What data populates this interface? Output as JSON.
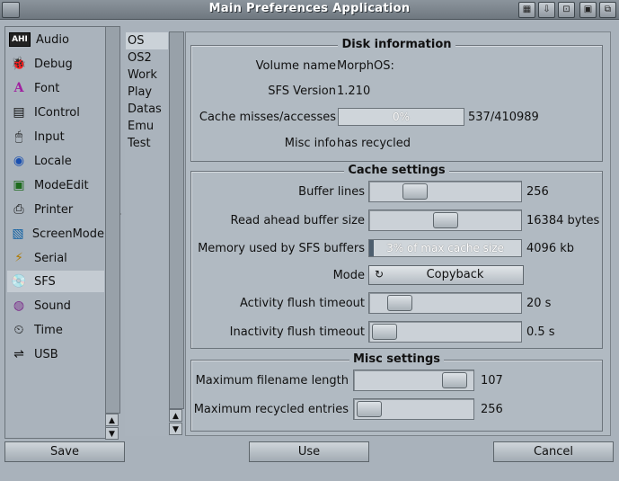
{
  "window": {
    "title": "Main Preferences Application"
  },
  "categories": [
    {
      "label": "Audio",
      "icon": "ahi-icon"
    },
    {
      "label": "Debug",
      "icon": "bug-icon"
    },
    {
      "label": "Font",
      "icon": "font-icon"
    },
    {
      "label": "IControl",
      "icon": "icontrol-icon"
    },
    {
      "label": "Input",
      "icon": "mouse-icon"
    },
    {
      "label": "Locale",
      "icon": "globe-icon"
    },
    {
      "label": "ModeEdit",
      "icon": "monitor-icon"
    },
    {
      "label": "Printer",
      "icon": "printer-icon"
    },
    {
      "label": "ScreenMode",
      "icon": "screen-icon"
    },
    {
      "label": "Serial",
      "icon": "serial-icon"
    },
    {
      "label": "SFS",
      "icon": "disk-icon"
    },
    {
      "label": "Sound",
      "icon": "sound-icon"
    },
    {
      "label": "Time",
      "icon": "clock-icon"
    },
    {
      "label": "USB",
      "icon": "usb-icon"
    }
  ],
  "selected_category": "SFS",
  "volumes": [
    "OS",
    "OS2",
    "Work",
    "Play",
    "Datas",
    "Emu",
    "Test"
  ],
  "selected_volume": "OS",
  "disk_info": {
    "title": "Disk information",
    "volume_name_label": "Volume name",
    "volume_name": "MorphOS:",
    "sfs_version_label": "SFS Version",
    "sfs_version": "1.210",
    "cache_label": "Cache misses/accesses",
    "cache_percent_text": "0%",
    "cache_percent": 0,
    "cache_counts": "537/410989",
    "misc_label": "Misc info",
    "misc_value": "has recycled"
  },
  "cache_settings": {
    "title": "Cache settings",
    "buffer_lines_label": "Buffer lines",
    "buffer_lines": "256",
    "read_ahead_label": "Read ahead buffer size",
    "read_ahead": "16384 bytes",
    "memory_label": "Memory used by SFS buffers",
    "memory_gauge_text": "3% of max cache size",
    "memory_percent": 3,
    "memory_value": "4096 kb",
    "mode_label": "Mode",
    "mode_value": "Copyback",
    "activity_label": "Activity flush timeout",
    "activity_value": "20 s",
    "inactivity_label": "Inactivity flush timeout",
    "inactivity_value": "0.5 s"
  },
  "misc_settings": {
    "title": "Misc settings",
    "max_filename_label": "Maximum filename length",
    "max_filename": "107",
    "max_recycled_label": "Maximum recycled entries",
    "max_recycled": "256"
  },
  "buttons": {
    "save": "Save",
    "use": "Use",
    "cancel": "Cancel"
  }
}
